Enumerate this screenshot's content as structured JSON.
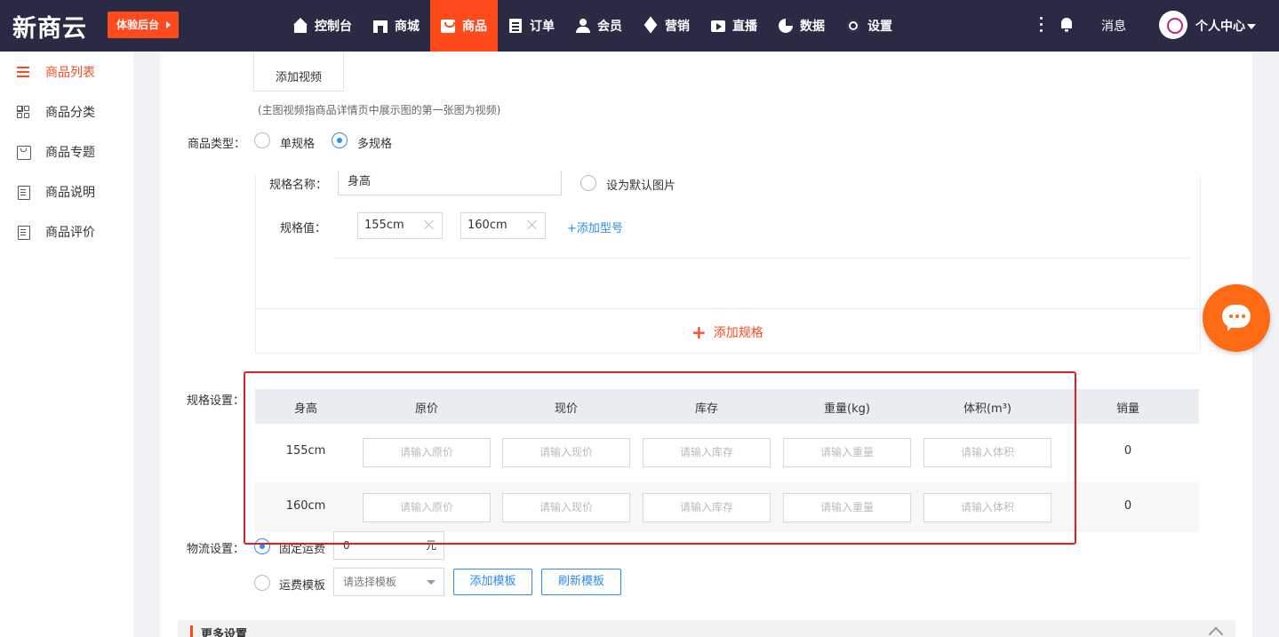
{
  "topbar": {
    "logo": "新商云",
    "trial_button": "体验后台",
    "nav": [
      {
        "label": "控制台",
        "icon": "home-icon"
      },
      {
        "label": "商城",
        "icon": "shop-icon"
      },
      {
        "label": "商品",
        "icon": "bag-icon",
        "active": true
      },
      {
        "label": "订单",
        "icon": "order-icon"
      },
      {
        "label": "会员",
        "icon": "user-icon"
      },
      {
        "label": "营销",
        "icon": "cube-icon"
      },
      {
        "label": "直播",
        "icon": "live-icon"
      },
      {
        "label": "数据",
        "icon": "pie-chart-icon"
      },
      {
        "label": "设置",
        "icon": "gear-icon"
      }
    ],
    "messages_label": "消息",
    "personal_center": "个人中心",
    "accent_color": "#ff4a1c",
    "bar_color": "#2a2a45"
  },
  "sidebar": {
    "items": [
      {
        "label": "商品列表",
        "icon": "list-icon",
        "active": true
      },
      {
        "label": "商品分类",
        "icon": "grid-icon"
      },
      {
        "label": "商品专题",
        "icon": "box-icon"
      },
      {
        "label": "商品说明",
        "icon": "doc-icon"
      },
      {
        "label": "商品评价",
        "icon": "doc-icon"
      }
    ]
  },
  "form": {
    "add_video_label": "添加视频",
    "video_hint": "(主图视频指商品详情页中展示图的第一张图为视频)",
    "product_type_label": "商品类型：",
    "product_type_options": [
      {
        "label": "单规格",
        "checked": false
      },
      {
        "label": "多规格",
        "checked": true
      }
    ],
    "spec_name_label": "规格名称：",
    "spec_name_value": "身高",
    "default_image_label": "设为默认图片",
    "spec_value_label": "规格值：",
    "spec_values": [
      "155cm",
      "160cm"
    ],
    "add_model_label": "+添加型号",
    "add_spec_label": "添加规格",
    "spec_settings_label": "规格设置：",
    "table": {
      "headers": [
        "身高",
        "原价",
        "现价",
        "库存",
        "重量(kg)",
        "体积(m³)",
        "销量"
      ],
      "placeholders": [
        "请输入原价",
        "请输入现价",
        "请输入库存",
        "请输入重量",
        "请输入体积"
      ],
      "rows": [
        {
          "spec": "155cm",
          "sales": "0"
        },
        {
          "spec": "160cm",
          "sales": "0"
        }
      ]
    },
    "logistics_label": "物流设置：",
    "fixed_shipping_label": "固定运费",
    "fixed_shipping_value": "0",
    "currency_unit": "元",
    "shipping_template_label": "运费模板",
    "template_placeholder": "请选择模板",
    "add_template_button": "添加模板",
    "refresh_template_button": "刷新模板",
    "more_settings_label": "更多设置"
  }
}
